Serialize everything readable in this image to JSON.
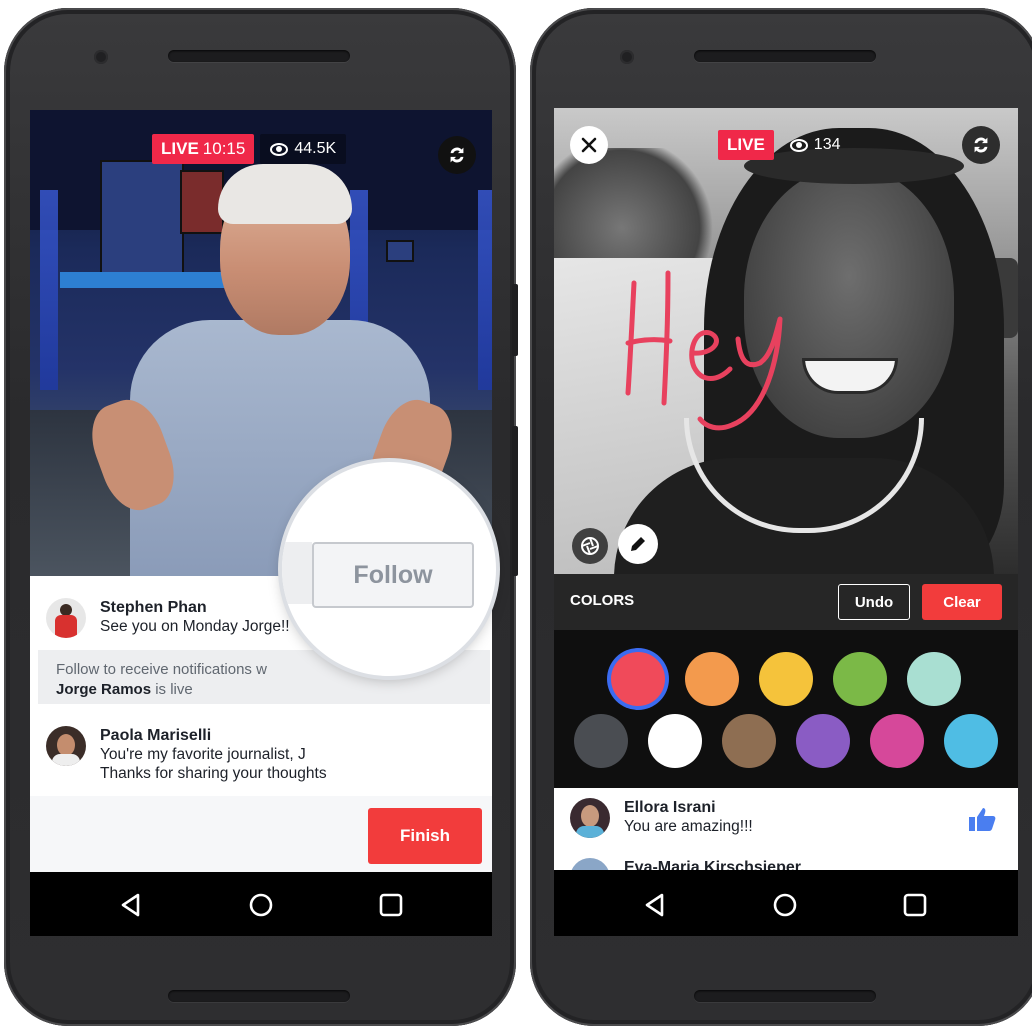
{
  "left_phone": {
    "live": {
      "label": "LIVE",
      "time": "10:15",
      "viewers": "44.5K"
    },
    "comments": [
      {
        "name": "Stephen Phan",
        "text": "See you on Monday Jorge!!"
      },
      {
        "name": "Paola Mariselli",
        "line1": "You're my favorite journalist, J",
        "line2": "Thanks for sharing your thoughts"
      }
    ],
    "follow_notice": {
      "line1": "Follow to receive notifications w",
      "name": "Jorge Ramos",
      "suffix": " is live"
    },
    "follow_button": "Follow",
    "finish_button": "Finish"
  },
  "right_phone": {
    "live": {
      "label": "LIVE",
      "viewers": "134"
    },
    "drawing_text": "Hey",
    "toolbar": {
      "colors_label": "COLORS",
      "undo_label": "Undo",
      "clear_label": "Clear"
    },
    "palette": {
      "row1": [
        "#f04a5a",
        "#f39a4d",
        "#f5c33b",
        "#7bb947",
        "#a9dfd2"
      ],
      "row2": [
        "#4a4d52",
        "#ffffff",
        "#8e6e52",
        "#8a5cc4",
        "#d6489a",
        "#4fbde4"
      ],
      "selected": "#f04a5a"
    },
    "comments": [
      {
        "name": "Ellora Israni",
        "text": "You are amazing!!!"
      },
      {
        "name": "Eva-Maria Kirschsieper"
      }
    ]
  },
  "icons": {
    "back": "triangle-left",
    "home": "circle",
    "recent": "square",
    "switch_camera": "rotate-arrows",
    "like": "thumbs-up",
    "pencil": "pencil",
    "close": "x",
    "shutter": "aperture"
  },
  "colors": {
    "live_red": "#f02849",
    "finish_red": "#f23c3c",
    "like_blue": "#4a7ef0"
  }
}
